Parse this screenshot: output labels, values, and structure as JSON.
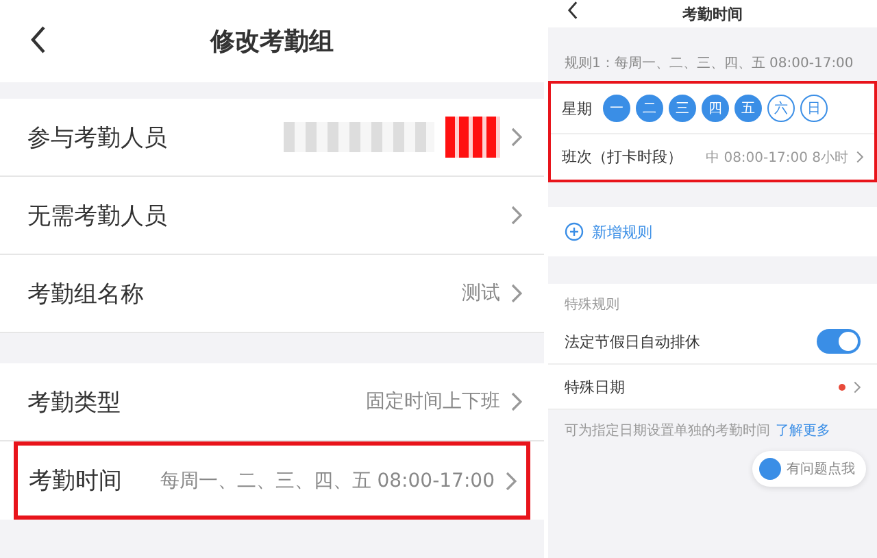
{
  "left_screen": {
    "title": "修改考勤组",
    "sections": [
      {
        "rows": [
          {
            "kind": "redacted",
            "label": "参与考勤人员",
            "highlighted": false
          },
          {
            "kind": "plain",
            "label": "无需考勤人员",
            "highlighted": false
          },
          {
            "kind": "value",
            "label": "考勤组名称",
            "value": "测试",
            "highlighted": false
          }
        ]
      },
      {
        "rows": [
          {
            "kind": "value",
            "label": "考勤类型",
            "value": "固定时间上下班",
            "highlighted": false
          },
          {
            "kind": "value",
            "label": "考勤时间",
            "value": "每周一、二、三、四、五 08:00-17:00",
            "highlighted": true
          }
        ]
      }
    ]
  },
  "right_screen": {
    "title": "考勤时间",
    "rule": {
      "summary": "规则1：每周一、二、三、四、五 08:00-17:00",
      "highlighted": true,
      "weekday_label": "星期",
      "weekdays": [
        {
          "label": "一",
          "selected": true
        },
        {
          "label": "二",
          "selected": true
        },
        {
          "label": "三",
          "selected": true
        },
        {
          "label": "四",
          "selected": true
        },
        {
          "label": "五",
          "selected": true
        },
        {
          "label": "六",
          "selected": false
        },
        {
          "label": "日",
          "selected": false
        }
      ],
      "shift_label": "班次（打卡时段）",
      "shift_value": "中 08:00-17:00 8小时"
    },
    "add_rule": "新增规则",
    "special_title": "特殊规则",
    "settings": [
      {
        "kind": "toggle",
        "label": "法定节假日自动排休",
        "on": true
      },
      {
        "kind": "link",
        "label": "特殊日期",
        "dot": true
      }
    ],
    "note": {
      "text": "可为指定日期设置单独的考勤时间",
      "link": "了解更多"
    },
    "help_button": "有问题点我"
  }
}
